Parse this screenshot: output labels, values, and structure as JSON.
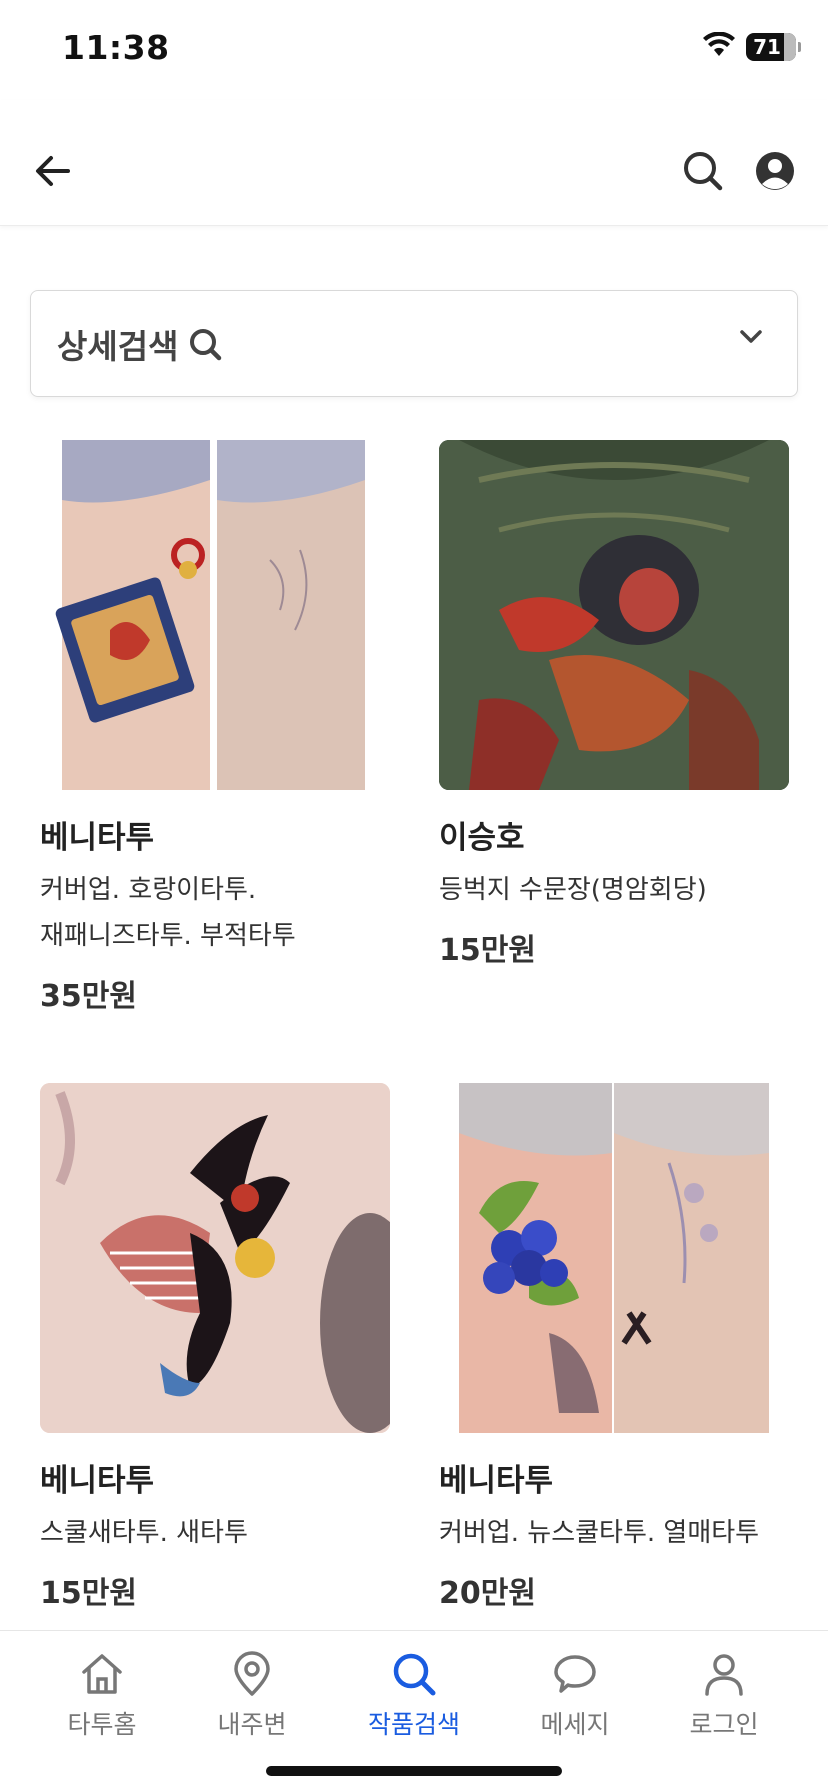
{
  "status": {
    "time": "11:38",
    "battery": "71"
  },
  "header": {
    "back_icon": "arrow-left-icon",
    "search_icon": "search-icon",
    "profile_icon": "user-circle-icon"
  },
  "filter": {
    "label": "상세검색",
    "chevron_icon": "chevron-down-icon"
  },
  "cards": [
    {
      "artist": "베니타투",
      "tags_line1": "커버업. 호랑이타투.",
      "tags_line2": "재패니즈타투. 부적타투",
      "price": "35만원"
    },
    {
      "artist": "이승호",
      "tags_line1": "등벅지 수문장(명암회당)",
      "tags_line2": "",
      "price": "15만원"
    },
    {
      "artist": "베니타투",
      "tags_line1": "스쿨새타투. 새타투",
      "tags_line2": "",
      "price": "15만원"
    },
    {
      "artist": "베니타투",
      "tags_line1": "커버업. 뉴스쿨타투. 열매타투",
      "tags_line2": "",
      "price": "20만원"
    }
  ],
  "tabs": [
    {
      "label": "타투홈",
      "icon": "home-icon"
    },
    {
      "label": "내주변",
      "icon": "map-pin-icon"
    },
    {
      "label": "작품검색",
      "icon": "search-icon",
      "active": true
    },
    {
      "label": "메세지",
      "icon": "chat-bubble-icon"
    },
    {
      "label": "로그인",
      "icon": "user-icon"
    }
  ],
  "colors": {
    "accent": "#1a5ce0",
    "text": "#222222",
    "muted": "#777777"
  }
}
